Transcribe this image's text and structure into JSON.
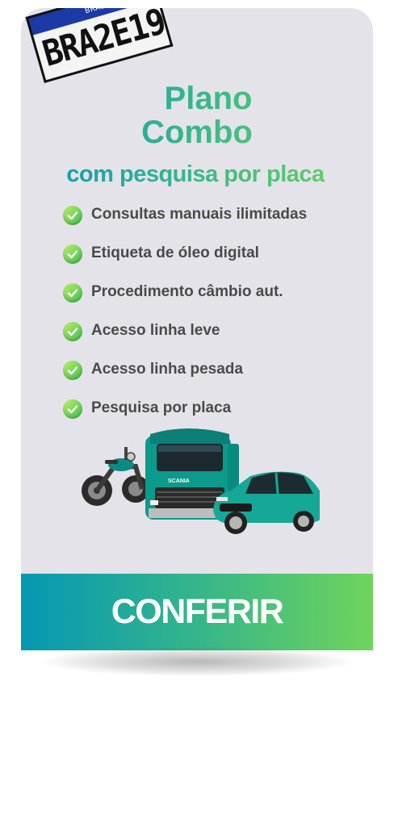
{
  "plate": {
    "country": "BRASIL",
    "number": "BRA2E19"
  },
  "heading": {
    "line1": "Plano",
    "line2": "Combo",
    "subtitle": "com pesquisa por placa"
  },
  "features": [
    {
      "label": "Consultas manuais ilimitadas",
      "icon": "check-icon"
    },
    {
      "label": "Etiqueta de óleo digital",
      "icon": "check-icon"
    },
    {
      "label": "Procedimento câmbio aut.",
      "icon": "check-icon"
    },
    {
      "label": "Acesso linha leve",
      "icon": "check-icon"
    },
    {
      "label": "Acesso linha pesada",
      "icon": "check-icon"
    },
    {
      "label": "Pesquisa por placa",
      "icon": "check-icon"
    }
  ],
  "vehicles": {
    "truck_brand": "SCANIA"
  },
  "cta": {
    "label": "CONFERIR"
  },
  "colors": {
    "gradient_start": "#0598b4",
    "gradient_end": "#70d45b",
    "card_background": "#e4e3e9",
    "feature_text": "#4a4a4a",
    "check_green": "#3bbd4a"
  }
}
